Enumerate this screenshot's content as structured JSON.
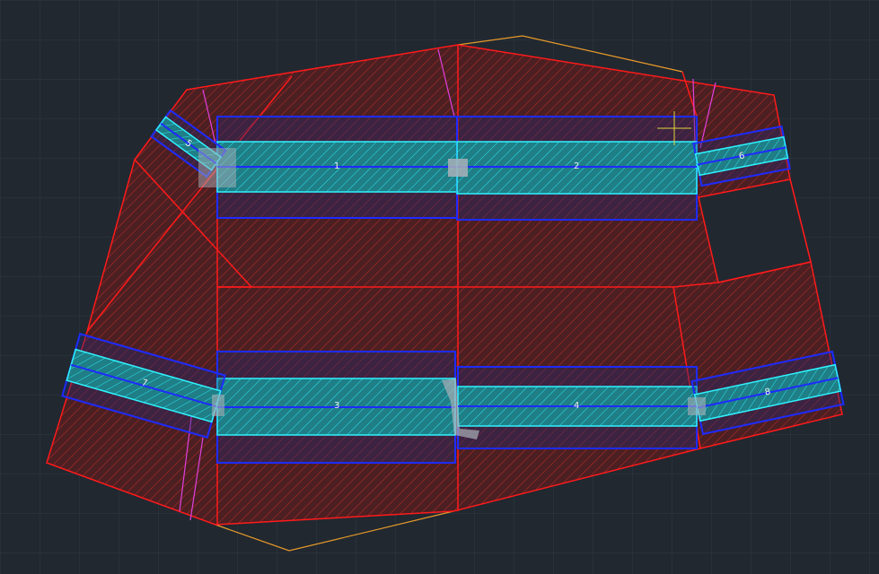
{
  "colors": {
    "background": "#212830",
    "grid": "#2f3843",
    "boundary": "#ff1a1a",
    "hatch": "#b02a2a",
    "beam_outline": "#1e2bff",
    "beam_core": "#2ef3ff",
    "core_fill": "#1f7e86",
    "orange_line": "#e89a2a",
    "magenta_line": "#e040e0",
    "grip": "#a9b0b8",
    "cursor": "#e3d53a"
  },
  "icons": {
    "cursor": "crosshair-cursor-icon"
  },
  "labels": {
    "b1": "1",
    "b2": "2",
    "b3": "3",
    "b4": "4",
    "b5": "5",
    "b6": "6",
    "b7": "7",
    "b8": "8"
  }
}
